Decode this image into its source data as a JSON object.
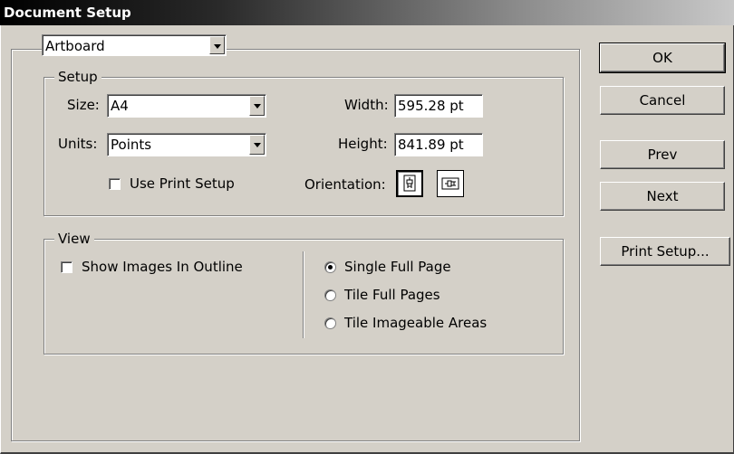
{
  "window": {
    "title": "Document Setup"
  },
  "section_select": {
    "value": "Artboard"
  },
  "setup": {
    "legend": "Setup",
    "size_label": "Size:",
    "size_value": "A4",
    "units_label": "Units:",
    "units_value": "Points",
    "use_print_setup_label": "Use Print Setup",
    "width_label": "Width:",
    "width_value": "595.28 pt",
    "height_label": "Height:",
    "height_value": "841.89 pt",
    "orientation_label": "Orientation:"
  },
  "view": {
    "legend": "View",
    "show_images_label": "Show Images In Outline",
    "radio_single": "Single Full Page",
    "radio_tile_full": "Tile Full Pages",
    "radio_tile_imageable": "Tile Imageable Areas"
  },
  "buttons": {
    "ok": "OK",
    "cancel": "Cancel",
    "prev": "Prev",
    "next": "Next",
    "print_setup": "Print Setup..."
  },
  "icons": {
    "dropdown": "chevron-down-icon",
    "portrait": "portrait-orientation-icon",
    "landscape": "landscape-orientation-icon"
  }
}
